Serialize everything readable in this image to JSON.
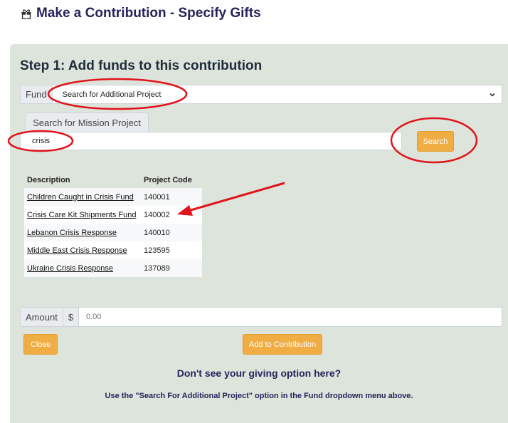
{
  "header": {
    "title": "Make a Contribution - Specify Gifts",
    "icon": "gift-icon"
  },
  "step": {
    "title": "Step 1: Add funds to this contribution"
  },
  "fund": {
    "label": "Fund",
    "selected": "Search for Additional Project"
  },
  "search": {
    "tab_label": "Search for Mission Project",
    "value": "crisis",
    "button_label": "Search"
  },
  "results": {
    "headers": {
      "description": "Description",
      "code": "Project Code"
    },
    "rows": [
      {
        "description": "Children Caught in Crisis Fund",
        "code": "140001"
      },
      {
        "description": "Crisis Care Kit Shipments Fund",
        "code": "140002"
      },
      {
        "description": "Lebanon Crisis Response",
        "code": "140010"
      },
      {
        "description": "Middle East Crisis Response",
        "code": "123595"
      },
      {
        "description": "Ukraine Crisis Response",
        "code": "137089"
      }
    ]
  },
  "amount": {
    "label": "Amount",
    "currency": "$",
    "placeholder": "0.00"
  },
  "buttons": {
    "close": "Close",
    "add": "Add to Contribution"
  },
  "help": {
    "title": "Don't see your giving option here?",
    "text": "Use the \"Search For Additional Project\" option in the Fund dropdown menu above."
  },
  "colors": {
    "accent": "#f0ad44",
    "panel": "#dde4db",
    "heading": "#25235b",
    "annotation": "#e0141b"
  }
}
